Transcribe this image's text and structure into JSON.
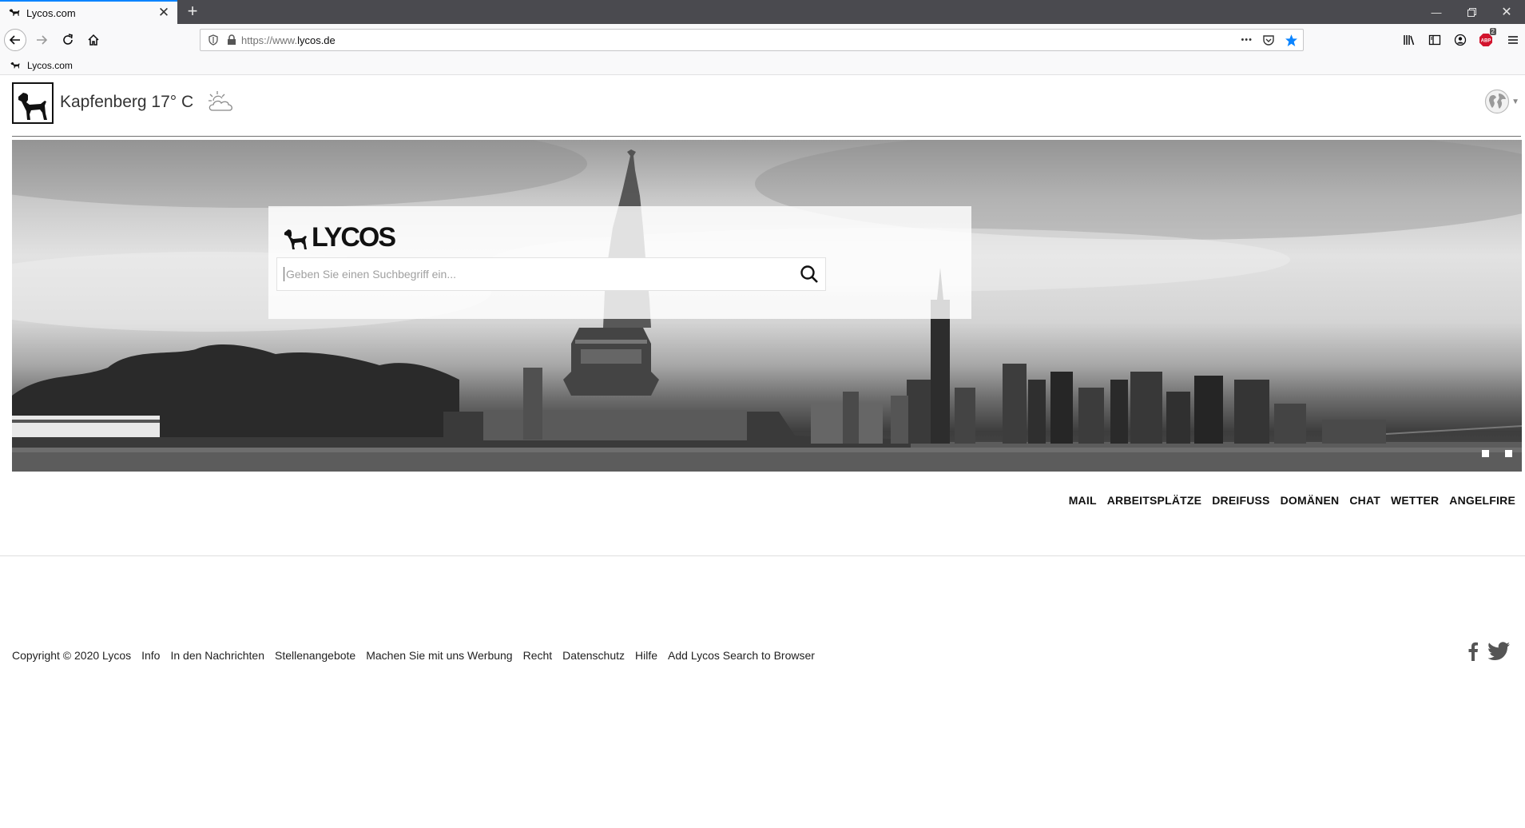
{
  "browser": {
    "tab_title": "Lycos.com",
    "new_tab_label": "+",
    "url_prefix": "https://www.",
    "url_domain": "lycos.de",
    "url_more": "•••",
    "abp_badge": "2",
    "bookmark_label": "Lycos.com"
  },
  "header": {
    "weather_text": "Kapfenberg 17° C",
    "weather_icon": "partly-cloudy-icon",
    "language_icon": "globe-icon"
  },
  "search": {
    "brand": "LYCOS",
    "placeholder": "Geben Sie einen Suchbegriff ein..."
  },
  "hero": {
    "slide_count": 2
  },
  "services": [
    "MAIL",
    "ARBEITSPLÄTZE",
    "DREIFUSS",
    "DOMÄNEN",
    "CHAT",
    "WETTER",
    "ANGELFIRE"
  ],
  "footer": {
    "links": [
      "Copyright © 2020 Lycos",
      "Info",
      "In den Nachrichten",
      "Stellenangebote",
      "Machen Sie mit uns Werbung",
      "Recht",
      "Datenschutz",
      "Hilfe",
      "Add Lycos Search to Browser"
    ]
  },
  "social": [
    "facebook-icon",
    "twitter-icon"
  ],
  "colors": {
    "accent": "#0a84ff",
    "tab_strip": "#4a4a4f",
    "text": "#111111"
  }
}
